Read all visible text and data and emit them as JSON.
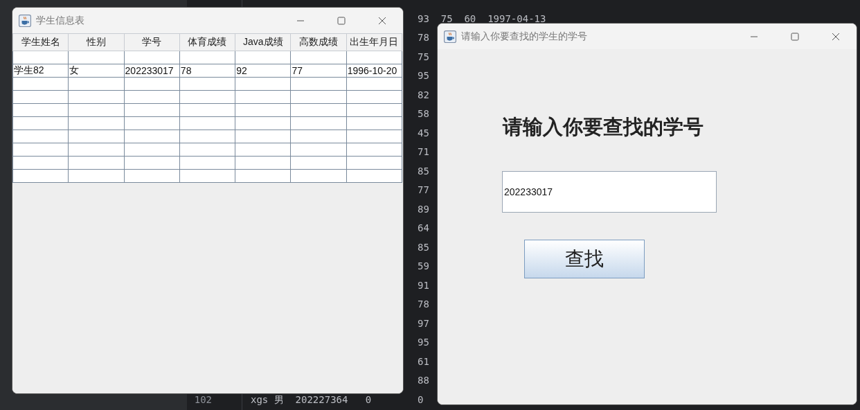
{
  "editor": {
    "lines": [
      {
        "tail": "93  75  60  1997-04-13"
      },
      {
        "tail": "78"
      },
      {
        "tail": "75"
      },
      {
        "tail": "95"
      },
      {
        "tail": "82"
      },
      {
        "tail": "58"
      },
      {
        "tail": "45"
      },
      {
        "tail": "71"
      },
      {
        "tail": "85"
      },
      {
        "tail": "77"
      },
      {
        "tail": "89"
      },
      {
        "tail": "64"
      },
      {
        "tail": "85"
      },
      {
        "tail": "59"
      },
      {
        "tail": "91"
      },
      {
        "tail": "78"
      },
      {
        "tail": "97"
      },
      {
        "tail": "95"
      },
      {
        "tail": "61"
      },
      {
        "tail": "88"
      },
      {
        "number": "102",
        "lead": "xgs 男  202227364   0",
        "tail": "0"
      }
    ]
  },
  "table_window": {
    "title": "学生信息表",
    "table": {
      "columns": [
        "学生姓名",
        "性别",
        "学号",
        "体育成绩",
        "Java成绩",
        "高数成绩",
        "出生年月日"
      ],
      "rows": [
        {
          "blank": true
        },
        {
          "cells": [
            "学生82",
            "女",
            "202233017",
            "78",
            "92",
            "77",
            "1996-10-20"
          ]
        },
        {
          "blank": true
        },
        {
          "blank": true
        },
        {
          "blank": true
        },
        {
          "blank": true
        },
        {
          "blank": true
        },
        {
          "blank": true
        },
        {
          "blank": true
        },
        {
          "blank": true
        }
      ]
    }
  },
  "search_window": {
    "title": "请输入你要查找的学生的学号",
    "heading": "请输入你要查找的学号",
    "field": {
      "value": "202233017"
    },
    "button": "查找"
  }
}
